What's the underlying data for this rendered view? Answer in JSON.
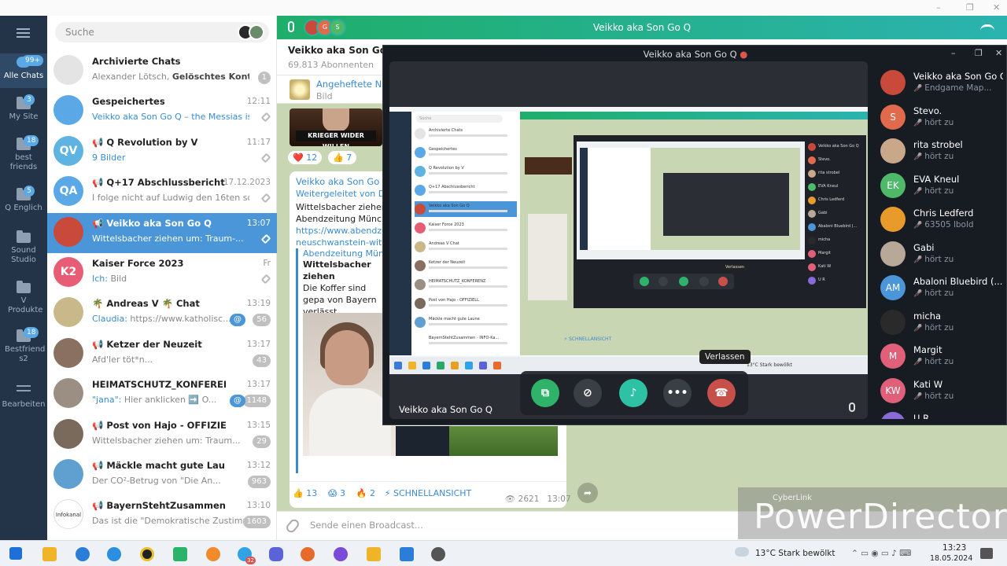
{
  "window_controls": [
    "–",
    "❐",
    "✕"
  ],
  "rail": {
    "items": [
      {
        "label": "Alle Chats",
        "badge": "99+"
      },
      {
        "label": "My Site",
        "badge": "3"
      },
      {
        "label": "best friends",
        "badge": "18"
      },
      {
        "label": "Q Englich",
        "badge": "5"
      },
      {
        "label": "Sound Studio",
        "badge": ""
      },
      {
        "label": "V Produkte",
        "badge": ""
      },
      {
        "label": "Bestfriend s2",
        "badge": "18"
      },
      {
        "label": "Bearbeiten",
        "badge": ""
      }
    ]
  },
  "search": {
    "placeholder": "Suche"
  },
  "chats": [
    {
      "avatar": "",
      "color": "#e4e4e4",
      "title": "Archivierte Chats",
      "time": "",
      "preview_prefix": "Alexander Lötsch, ",
      "preview_bold": "Gelöschtes Konto",
      "preview": ", G...",
      "count": "1",
      "at": ""
    },
    {
      "avatar": "",
      "color": "#5aa9e6",
      "title": "Gespeichertes",
      "time": "12:11",
      "preview_prefix": "",
      "preview_bold": "",
      "preview_acc": "Veikko aka Son Go Q – the Messias is u...",
      "preview": "",
      "count": "",
      "at": ""
    },
    {
      "avatar": "QV",
      "color": "#5fb3e0",
      "title": "📢 Q Revolution by V",
      "time": "11:17",
      "preview_prefix": "",
      "preview_bold": "",
      "preview_acc": "9 Bilder",
      "preview": "",
      "count": "",
      "at": ""
    },
    {
      "avatar": "QA",
      "color": "#5aa9e6",
      "title": "📢 Q+17 Abschlussbericht",
      "time": "17.12.2023",
      "preview_prefix": "",
      "preview_bold": "",
      "preview": "I folge nicht auf Ludwig den 16ten sond...",
      "count": "",
      "at": ""
    },
    {
      "avatar": "",
      "color": "#c94a3a",
      "title": "📢 Veikko aka Son Go Q",
      "time": "13:07",
      "preview_prefix": "",
      "preview_bold": "",
      "preview": "Wittelsbacher ziehen um: Traum-...",
      "count": "",
      "at": ""
    },
    {
      "avatar": "K2",
      "color": "#e85d76",
      "title": "Kaiser Force 2023",
      "time": "Fr",
      "preview_prefix": "",
      "preview_bold": "",
      "preview_acc": "Ich:",
      "preview": " Bild",
      "count": "",
      "at": ""
    },
    {
      "avatar": "",
      "color": "#c9b88a",
      "title": "🌴 Andreas V 🌴 Chat",
      "time": "13:19",
      "preview_prefix": "",
      "preview_bold": "",
      "preview_acc": "Claudia:",
      "preview": " https://www.katholisc...",
      "count": "56",
      "at": "@"
    },
    {
      "avatar": "",
      "color": "#8a7060",
      "title": "📢 Ketzer der Neuzeit",
      "time": "13:17",
      "preview_prefix": "",
      "preview_bold": "",
      "preview": "Afd'ler töt*n...",
      "count": "43",
      "at": ""
    },
    {
      "avatar": "",
      "color": "#9a8f82",
      "title": "HEIMATSCHUTZ_KONFERENZ",
      "time": "13:17",
      "preview_prefix": "",
      "preview_bold": "",
      "preview_acc": "\"jana\":",
      "preview": " Hier anklicken ➡️ O...",
      "count": "1148",
      "at": "@"
    },
    {
      "avatar": "",
      "color": "#7a6a5c",
      "title": "📢 Post von Hajo - OFFIZIELL",
      "time": "13:15",
      "preview_prefix": "",
      "preview_bold": "",
      "preview": "Wittelsbacher ziehen um: Traum...",
      "count": "29",
      "at": ""
    },
    {
      "avatar": "",
      "color": "#5fa0d0",
      "title": "📢 Mäckle macht gute Laune",
      "time": "13:12",
      "preview_prefix": "",
      "preview_bold": "",
      "preview": "Der CO²-Betrug von \"Die An...",
      "count": "963",
      "at": ""
    },
    {
      "avatar": "Infokanal",
      "color": "#ffffff",
      "title": "📢 BayernStehtZusammen - INFO-Ka...",
      "time": "13:10",
      "preview_prefix": "",
      "preview_bold": "",
      "preview": "Das ist die \"Demokratische Zustimm...",
      "count": "1603",
      "at": ""
    }
  ],
  "callbar": {
    "title": "Veikko aka Son Go Q",
    "avatars": [
      "",
      "G",
      "S"
    ]
  },
  "pane": {
    "title": "Veikko aka Son Go Q",
    "subtitle": "69.813 Abonnenten",
    "pinned_label": "Angeheftete Nac",
    "pinned_sub": "Bild",
    "image_banner": "KRIEGER WIDER WILLEN",
    "reactions_top": [
      "❤️ 12",
      "👍 7"
    ],
    "card": {
      "author": "Veikko aka Son Go Q",
      "forwarded": "Weitergeleitet von Do",
      "text": "Wittelsbacher ziehen u Abendzeitung Münche",
      "link": "https://www.abendzeit neuschwanstein-witte",
      "quote_title": "Abendzeitung Münch",
      "quote_bold": "Wittelsbacher ziehen",
      "quote_text": "Die Koffer sind gepa von Bayern verlässt Traumschloss nahe N",
      "quick": "⚡ SCHNELLANSICHT"
    },
    "reactions_bottom": [
      "👍 13",
      "😱 3",
      "🔥 2"
    ],
    "views": "👁 2621",
    "msg_time": "13:07",
    "composer_placeholder": "Sende einen Broadcast..."
  },
  "video": {
    "title": "Veikko aka Son Go Q",
    "stage_name": "Veikko aka Son Go Q",
    "tooltip": "Verlassen",
    "screen": {
      "search": "Suche",
      "rows": [
        "Archivierte Chats",
        "Gespeichertes",
        "Q Revolution by V",
        "Q+17 Abschlussbericht",
        "Veikko aka Son Go Q",
        "Kaiser Force 2023",
        "Andreas V Chat",
        "Ketzer der Neuzeit",
        "HEIMATSCHUTZ_KONFERENZ",
        "Post von Hajo - OFFIZIELL",
        "Mäckle macht gute Laune",
        "BayernStehtZusammen - INFO-Ka..."
      ],
      "side": [
        "Veikko aka Son Go Q",
        "Stevo.",
        "rita strobel",
        "EVA Kneul",
        "Chris Ledferd",
        "Gabi",
        "Abaloni Bluebird (...",
        "micha",
        "Margit",
        "Kati W",
        "U R"
      ],
      "taskbar_weather": "13°C Stark bewölkt",
      "quick": "⚡ SCHNELLANSICHT",
      "mini_tooltip": "Verlassen"
    },
    "participants": [
      {
        "initials": "",
        "color": "#c94a3a",
        "name": "Veikko aka Son Go Q",
        "status": "Endgame Map..."
      },
      {
        "initials": "S",
        "color": "#e26a4c",
        "name": "Stevo.",
        "status": "hört zu"
      },
      {
        "initials": "",
        "color": "#c9a88a",
        "name": "rita strobel",
        "status": "hört zu"
      },
      {
        "initials": "EK",
        "color": "#4fb96a",
        "name": "EVA Kneul",
        "status": "hört zu"
      },
      {
        "initials": "",
        "color": "#e89a2a",
        "name": "Chris Ledferd",
        "status": "63505 lbold"
      },
      {
        "initials": "",
        "color": "#b8a898",
        "name": "Gabi",
        "status": "hört zu"
      },
      {
        "initials": "AM",
        "color": "#4a96d8",
        "name": "Abaloni Bluebird (...",
        "status": "hört zu"
      },
      {
        "initials": "",
        "color": "#2a2a2a",
        "name": "micha",
        "status": "hört zu"
      },
      {
        "initials": "M",
        "color": "#e0607a",
        "name": "Margit",
        "status": "hört zu"
      },
      {
        "initials": "KW",
        "color": "#e0607a",
        "name": "Kati W",
        "status": "hört zu"
      },
      {
        "initials": "",
        "color": "#8a6ad8",
        "name": "U R",
        "status": ""
      }
    ]
  },
  "watermark": {
    "small": "CyberLink",
    "big": "PowerDirector"
  },
  "taskbar": {
    "weather": "13°C  Stark bewölkt",
    "time": "13:23",
    "date": "18.05.2024"
  }
}
